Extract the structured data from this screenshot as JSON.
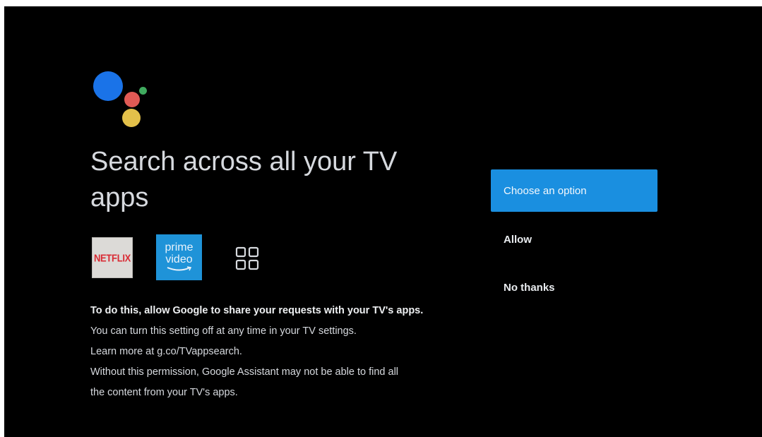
{
  "icons": {
    "assistant": "google-assistant-icon",
    "more_apps": "grid-apps-icon"
  },
  "colors": {
    "background": "#000000",
    "accent": "#1a8fe0",
    "assistant_blue": "#1a73e8",
    "assistant_red": "#e05a55",
    "assistant_yellow": "#e3c04a",
    "assistant_green": "#3faa5e"
  },
  "title": "Search across all your TV apps",
  "apps": {
    "netflix": "NETFLIX",
    "prime_line1": "prime",
    "prime_line2": "video"
  },
  "body": {
    "line1": "To do this, allow Google to share your requests with your TV's apps.",
    "line2": "You can turn this setting off at any time in your TV settings.",
    "line3": "Learn more at g.co/TVappsearch.",
    "line4": "Without this permission, Google Assistant may not be able to find all",
    "line5": "the content from your TV's apps."
  },
  "options": {
    "choose": "Choose an option",
    "allow": "Allow",
    "no_thanks": "No thanks"
  }
}
